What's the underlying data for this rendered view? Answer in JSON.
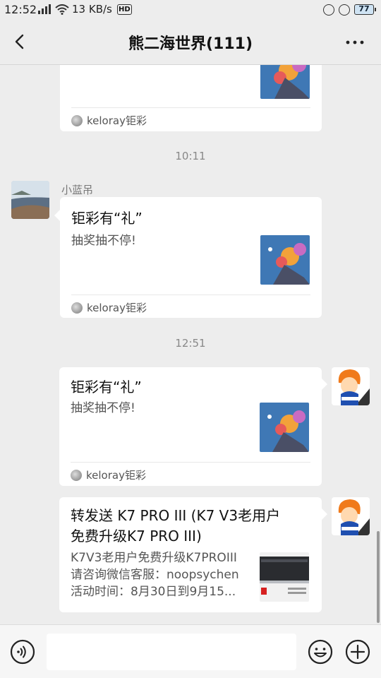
{
  "status_bar": {
    "time": "12:52",
    "speed": "13 KB/s",
    "hd": "HD",
    "battery": "77"
  },
  "header": {
    "title": "熊二海世界(111)",
    "back_icon": "chevron-left-icon",
    "more_icon": "more-horizontal-icon"
  },
  "messages": [
    {
      "type": "link-card",
      "from": "other",
      "partial": true,
      "source": "keloray钜彩"
    },
    {
      "type": "timestamp",
      "text": "10:11"
    },
    {
      "type": "link-card",
      "from": "other",
      "sender": "小蓝吊",
      "title": "钜彩有“礼”",
      "desc": "抽奖抽不停!",
      "source": "keloray钜彩"
    },
    {
      "type": "timestamp",
      "text": "12:51"
    },
    {
      "type": "link-card",
      "from": "self",
      "title": "钜彩有“礼”",
      "desc": "抽奖抽不停!",
      "source": "keloray钜彩"
    },
    {
      "type": "link-card",
      "from": "self",
      "title_lines": [
        "转发送 K7 PRO III (K7 V3老用户",
        "免费升级K7 PRO III)"
      ],
      "desc_lines": [
        "K7V3老用户免费升级K7PROIII",
        "请咨询微信客服：noopsychen",
        "活动时间：8月30日到9月15..."
      ]
    }
  ],
  "input_bar": {
    "voice_icon": "voice-icon",
    "input_value": "",
    "emoji_icon": "emoji-icon",
    "plus_icon": "plus-circle-icon"
  },
  "colors": {
    "chat_background": "#ededed",
    "bubble": "#ffffff",
    "thumbnail_blue": "#3f78b5"
  }
}
